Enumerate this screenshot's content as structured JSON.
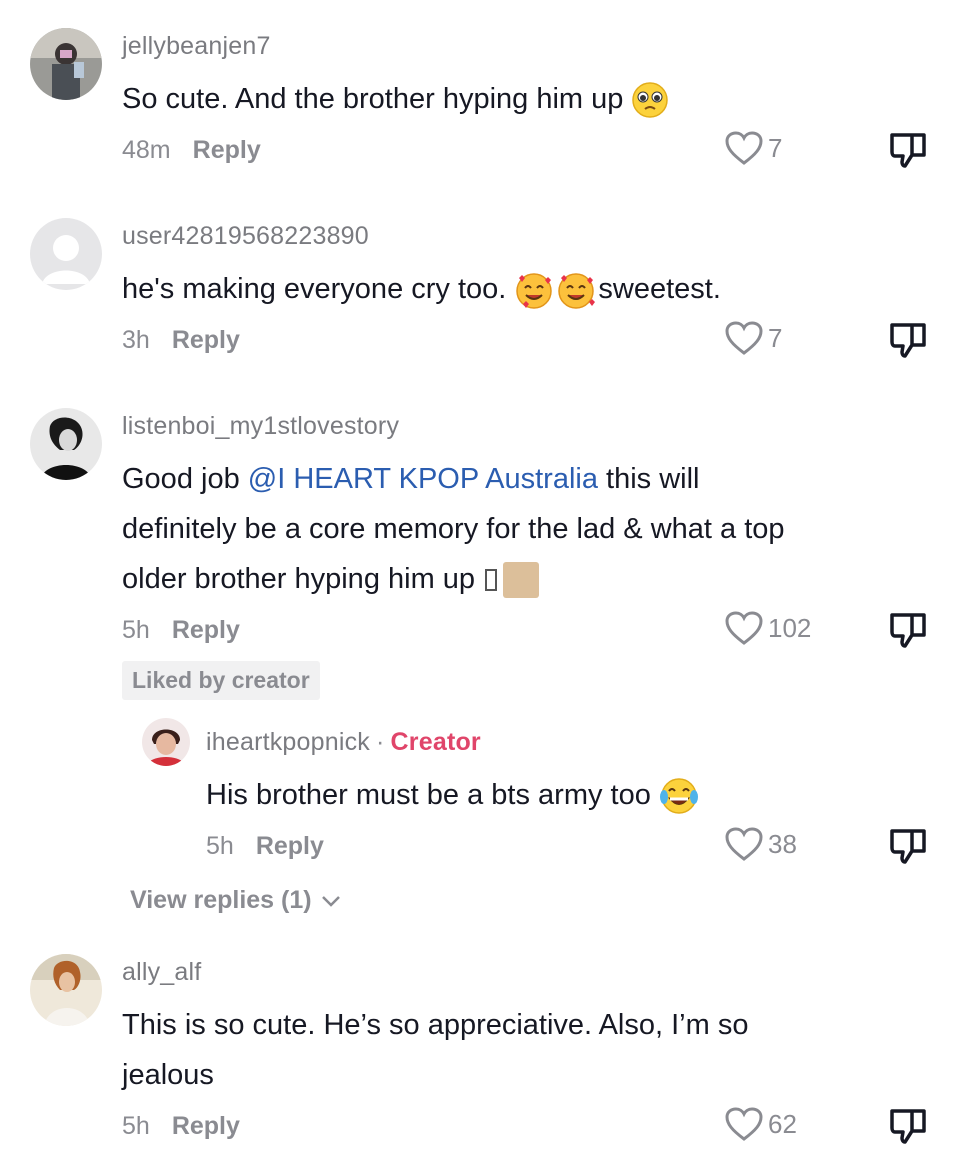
{
  "comments": [
    {
      "username": "jellybeanjen7",
      "text": "So cute. And the brother hyping him up",
      "emoji": "pleading-face",
      "time": "48m",
      "reply_label": "Reply",
      "likes": "7"
    },
    {
      "username": "user42819568223890",
      "text_before": "he's making everyone cry too.",
      "emoji": "smiling-face-with-hearts",
      "text_after": "sweetest.",
      "time": "3h",
      "reply_label": "Reply",
      "likes": "7"
    },
    {
      "username": "listenboi_my1stlovestory",
      "line1_before": "Good job",
      "mention": "@I HEART KPOP Australia",
      "line1_after": "this will",
      "line2": "definitely be a core memory for the lad & what a top",
      "line3": "older brother hyping him up",
      "time": "5h",
      "reply_label": "Reply",
      "likes": "102",
      "badge": "Liked by creator",
      "reply": {
        "username": "iheartkpopnick",
        "separator": "·",
        "creator_tag": "Creator",
        "text": "His brother must be a bts army too",
        "emoji": "face-with-tears-of-joy",
        "time": "5h",
        "reply_label": "Reply",
        "likes": "38"
      },
      "view_replies": "View replies (1)"
    },
    {
      "username": "ally_alf",
      "line1": "This is so cute. He’s so appreciative. Also, I’m so",
      "line2": "jealous",
      "time": "5h",
      "reply_label": "Reply",
      "likes": "62"
    }
  ],
  "colors": {
    "text": "#161823",
    "secondary": "#8a8b91",
    "mention": "#2b5db0",
    "creator": "#e0456a",
    "badge_bg": "#f1f1f2"
  },
  "icons": [
    "heart-outline-icon",
    "thumbs-down-icon",
    "chevron-down-icon"
  ]
}
